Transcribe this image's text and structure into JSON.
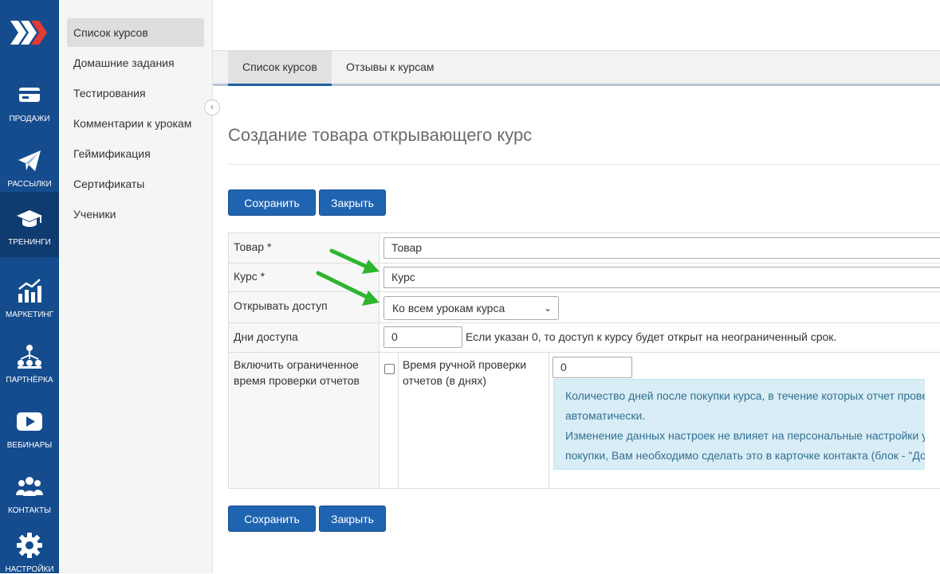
{
  "rail": {
    "items": [
      {
        "label": "ПРОДАЖИ",
        "icon": "card-icon"
      },
      {
        "label": "РАССЫЛКИ",
        "icon": "paper-plane-icon"
      },
      {
        "label": "ТРЕНИНГИ",
        "icon": "graduation-cap-icon"
      },
      {
        "label": "МАРКЕТИНГ",
        "icon": "chart-icon"
      },
      {
        "label": "ПАРТНЁРКА",
        "icon": "network-icon"
      },
      {
        "label": "ВЕБИНАРЫ",
        "icon": "play-icon"
      },
      {
        "label": "КОНТАКТЫ",
        "icon": "users-icon"
      },
      {
        "label": "НАСТРОЙКИ",
        "icon": "gear-icon"
      }
    ],
    "active": "ТРЕНИНГИ"
  },
  "submenu": {
    "items": [
      {
        "label": "Список курсов"
      },
      {
        "label": "Домашние задания"
      },
      {
        "label": "Тестирования"
      },
      {
        "label": "Комментарии к урокам"
      },
      {
        "label": "Геймификация"
      },
      {
        "label": "Сертификаты"
      },
      {
        "label": "Ученики"
      }
    ],
    "active": "Список курсов"
  },
  "tabs": [
    {
      "label": "Список курсов"
    },
    {
      "label": "Отзывы к курсам"
    }
  ],
  "page": {
    "title": "Создание товара открывающего курс",
    "save_label": "Сохранить",
    "close_label": "Закрыть"
  },
  "form": {
    "product": {
      "label": "Товар *",
      "value": "Товар"
    },
    "course": {
      "label": "Курс *",
      "value": "Курс"
    },
    "access": {
      "label": "Открывать доступ",
      "value": "Ко всем урокам курса"
    },
    "days": {
      "label": "Дни доступа",
      "value": "0",
      "hint": "Если указан 0, то доступ к курсу будет открыт на неограниченный срок."
    },
    "limit": {
      "label_line1": "Включить ограниченное",
      "label_line2": "время проверки отчетов",
      "checked": false,
      "manual_label_line1": "Время ручной проверки",
      "manual_label_line2": "отчетов (в днях)",
      "manual_value": "0",
      "info_line1": "Количество дней после покупки курса, в течение которых отчет проверя",
      "info_line2": "автоматически.",
      "info_line3": "Изменение данных настроек не влияет на персональные настройки учен",
      "info_line4": "покупки, Вам необходимо сделать это в карточке контакта (блок - \"Досту"
    }
  },
  "colors": {
    "rail": "#154c8e",
    "primary_button": "#1f64b1",
    "arrow": "#2db52d",
    "info_bg": "#d9edf7"
  }
}
